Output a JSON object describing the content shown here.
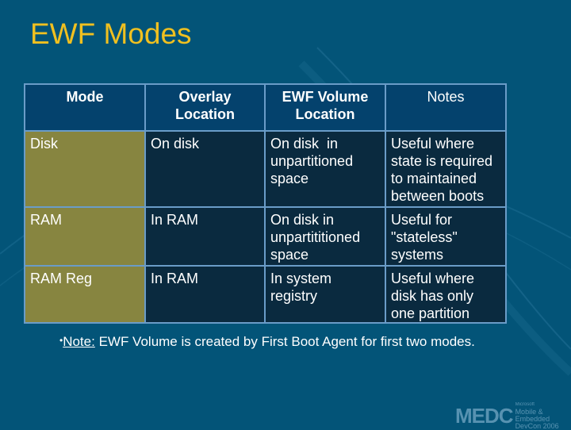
{
  "slide": {
    "title": "EWF Modes",
    "colors": {
      "background": "#035478",
      "title": "#f0c020",
      "header_cell": "#04426d",
      "mode_cell": "#878540",
      "body_cell": "#0a2a3f",
      "border": "#6a9cc8"
    }
  },
  "table": {
    "headers": [
      "Mode",
      "Overlay Location",
      "EWF Volume Location",
      "Notes"
    ],
    "rows": [
      {
        "mode": "Disk",
        "overlay": "On disk",
        "volume": "On disk  in unpartitioned space",
        "notes": "Useful where state is required to maintained between boots"
      },
      {
        "mode": "RAM",
        "overlay": "In RAM",
        "volume": "On disk in unpartititioned space",
        "notes": "Useful for \"stateless\" systems"
      },
      {
        "mode": "RAM Reg",
        "overlay": "In RAM",
        "volume": "In system registry",
        "notes": "Useful where disk has only one partition"
      }
    ]
  },
  "note": {
    "bullet": "•",
    "label": "Note:",
    "text": " EWF Volume is created by First Boot Agent for first two modes."
  },
  "logo": {
    "mark": "MEDC",
    "company": "Microsoft",
    "line1": "Mobile & Embedded",
    "line2": "DevCon 2006"
  }
}
